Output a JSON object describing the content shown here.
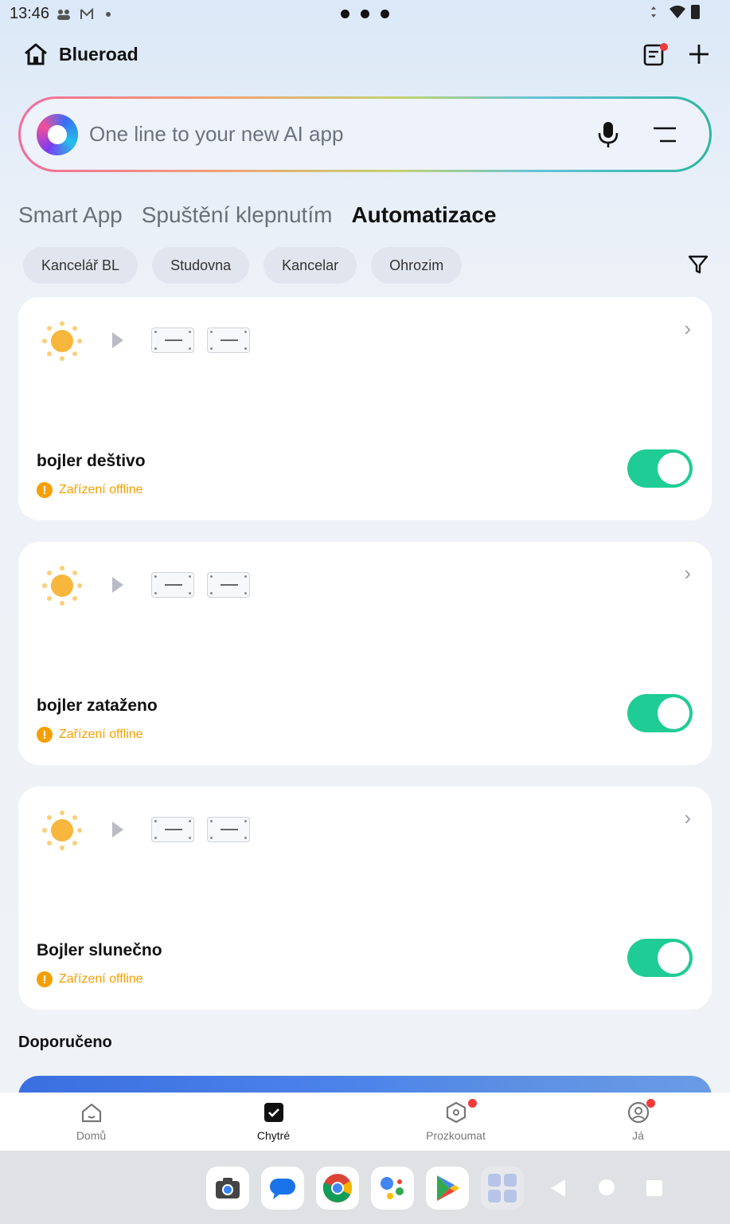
{
  "status_bar": {
    "time": "13:46"
  },
  "header": {
    "title": "Blueroad"
  },
  "search": {
    "placeholder": "One line to your new AI app"
  },
  "tabs": [
    {
      "label": "Smart App",
      "active": false
    },
    {
      "label": "Spuštění klepnutím",
      "active": false
    },
    {
      "label": "Automatizace",
      "active": true
    }
  ],
  "rooms": [
    "Kancelář BL",
    "Studovna",
    "Kancelar",
    "Ohrozim"
  ],
  "automations": [
    {
      "name": "bojler deštivo",
      "status": "Zařízení offline",
      "enabled": true
    },
    {
      "name": "bojler zataženo",
      "status": "Zařízení offline",
      "enabled": true
    },
    {
      "name": "Bojler slunečno",
      "status": "Zařízení offline",
      "enabled": true
    }
  ],
  "recommended": {
    "title": "Doporučeno"
  },
  "bottom_nav": [
    {
      "label": "Domů",
      "icon": "home-icon",
      "active": false
    },
    {
      "label": "Chytré",
      "icon": "smart-icon",
      "active": true
    },
    {
      "label": "Prozkoumat",
      "icon": "explore-icon",
      "active": false
    },
    {
      "label": "Já",
      "icon": "profile-icon",
      "active": false
    }
  ],
  "colors": {
    "toggle_on": "#1fcc95",
    "warning": "#f5a000",
    "badge": "#f03a3a"
  }
}
